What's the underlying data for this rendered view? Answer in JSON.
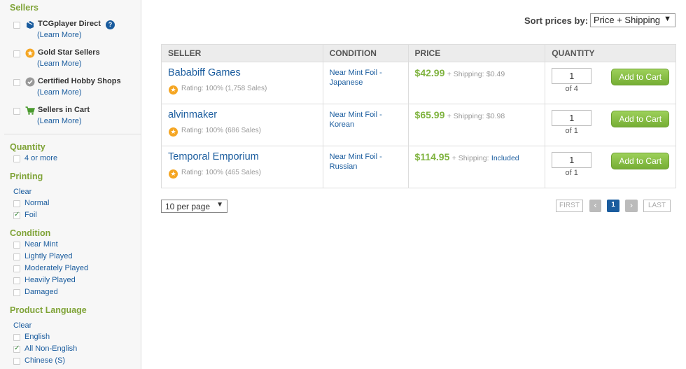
{
  "sidebar": {
    "sellers_heading": "Sellers",
    "sellers": [
      {
        "name": "TCGplayer Direct",
        "learn": "(Learn More)"
      },
      {
        "name": "Gold Star Sellers",
        "learn": "(Learn More)"
      },
      {
        "name": "Certified Hobby Shops",
        "learn": "(Learn More)"
      },
      {
        "name": "Sellers in Cart",
        "learn": "(Learn More)"
      }
    ],
    "help_glyph": "?",
    "quantity_heading": "Quantity",
    "quantity_options": [
      "4 or more"
    ],
    "printing_heading": "Printing",
    "printing_clear": "Clear",
    "printing_options": [
      "Normal",
      "Foil"
    ],
    "condition_heading": "Condition",
    "condition_options": [
      "Near Mint",
      "Lightly Played",
      "Moderately Played",
      "Heavily Played",
      "Damaged"
    ],
    "language_heading": "Product Language",
    "language_clear": "Clear",
    "language_options": [
      "English",
      "All Non-English",
      "Chinese (S)"
    ]
  },
  "sort": {
    "label": "Sort prices by:",
    "value": "Price + Shipping"
  },
  "table": {
    "headers": [
      "SELLER",
      "CONDITION",
      "PRICE",
      "QUANTITY"
    ],
    "rows": [
      {
        "seller": "Bababiff Games",
        "rating": "Rating: 100% (1,758 Sales)",
        "condition": "Near Mint Foil - Japanese",
        "price": "$42.99",
        "shipping_prefix": "+ Shipping:",
        "shipping": "$0.49",
        "qty": "1",
        "of": "of 4",
        "cart": "Add to Cart"
      },
      {
        "seller": "alvinmaker",
        "rating": "Rating: 100% (686 Sales)",
        "condition": "Near Mint Foil - Korean",
        "price": "$65.99",
        "shipping_prefix": "+ Shipping:",
        "shipping": "$0.98",
        "qty": "1",
        "of": "of 1",
        "cart": "Add to Cart"
      },
      {
        "seller": "Temporal Emporium",
        "rating": "Rating: 100% (465 Sales)",
        "condition": "Near Mint Foil - Russian",
        "price": "$114.95",
        "shipping_prefix": "+ Shipping:",
        "shipping": "Included",
        "qty": "1",
        "of": "of 1",
        "cart": "Add to Cart"
      }
    ]
  },
  "pagination": {
    "per_page": "10 per page",
    "first": "FIRST",
    "prev": "‹",
    "current": "1",
    "next": "›",
    "last": "LAST"
  },
  "colors": {
    "accent_green": "#7fb33f",
    "link_blue": "#1a5c9e",
    "star_orange": "#f5a623"
  }
}
